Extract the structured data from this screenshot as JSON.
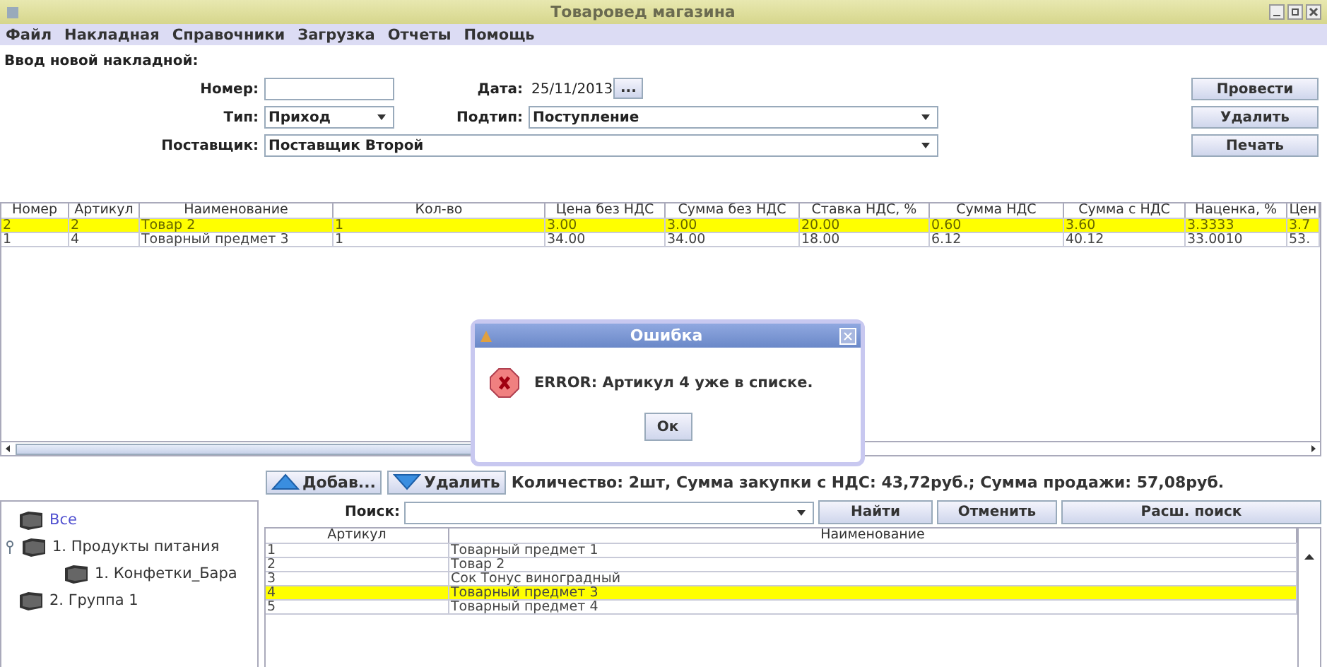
{
  "window": {
    "title": "Товаровед магазина"
  },
  "menu": [
    "Файл",
    "Накладная",
    "Справочники",
    "Загрузка",
    "Отчеты",
    "Помощь"
  ],
  "form": {
    "heading": "Ввод новой накладной:",
    "number": {
      "label": "Номер:"
    },
    "date": {
      "label": "Дата:",
      "value": "25/11/2013",
      "button": "..."
    },
    "type": {
      "label": "Тип:",
      "value": "Приход"
    },
    "subtype": {
      "label": "Подтип:",
      "value": "Поступление"
    },
    "supplier": {
      "label": "Поставщик:",
      "value": "Поставщик Второй"
    }
  },
  "actions": [
    "Провести",
    "Удалить",
    "Печать"
  ],
  "table": {
    "columns": [
      "Номер",
      "Артикул",
      "Наименование",
      "Кол-во",
      "Цена без НДС",
      "Сумма без НДС",
      "Ставка НДС, %",
      "Сумма НДС",
      "Сумма с НДС",
      "Наценка, %",
      "Цен"
    ],
    "rows": [
      {
        "selected": true,
        "cells": [
          "2",
          "2",
          "Товар 2",
          "1",
          "3.00",
          "3.00",
          "20.00",
          "0.60",
          "3.60",
          "3.3333",
          "3.7"
        ]
      },
      {
        "selected": false,
        "cells": [
          "1",
          "4",
          "Товарный предмет 3",
          "1",
          "34.00",
          "34.00",
          "18.00",
          "6.12",
          "40.12",
          "33.0010",
          "53."
        ]
      }
    ]
  },
  "toolbar": {
    "add": "Добав...",
    "remove": "Удалить",
    "summary": "Количество: 2шт, Сумма закупки с НДС: 43,72руб.; Сумма продажи: 57,08руб."
  },
  "tree": [
    {
      "label": "Все",
      "selected": true
    },
    {
      "label": "1. Продукты питания",
      "selected": false,
      "expanded": true,
      "children": [
        {
          "label": "1. Конфетки_Бара",
          "selected": false
        }
      ]
    },
    {
      "label": "2. Группа 1",
      "selected": false
    }
  ],
  "search": {
    "label": "Поиск:",
    "buttons": [
      "Найти",
      "Отменить",
      "Расш. поиск"
    ]
  },
  "catalog": {
    "columns": [
      "Артикул",
      "Наименование"
    ],
    "rows": [
      {
        "selected": false,
        "cells": [
          "1",
          "Товарный предмет 1"
        ]
      },
      {
        "selected": false,
        "cells": [
          "2",
          "Товар 2"
        ]
      },
      {
        "selected": false,
        "cells": [
          "3",
          "Сок Тонус виноградный"
        ]
      },
      {
        "selected": true,
        "cells": [
          "4",
          "Товарный предмет 3"
        ]
      },
      {
        "selected": false,
        "cells": [
          "5",
          "Товарный предмет 4"
        ]
      }
    ]
  },
  "dialog": {
    "title": "Ошибка",
    "message": "ERROR: Артикул 4 уже в списке.",
    "button": "Ок"
  }
}
